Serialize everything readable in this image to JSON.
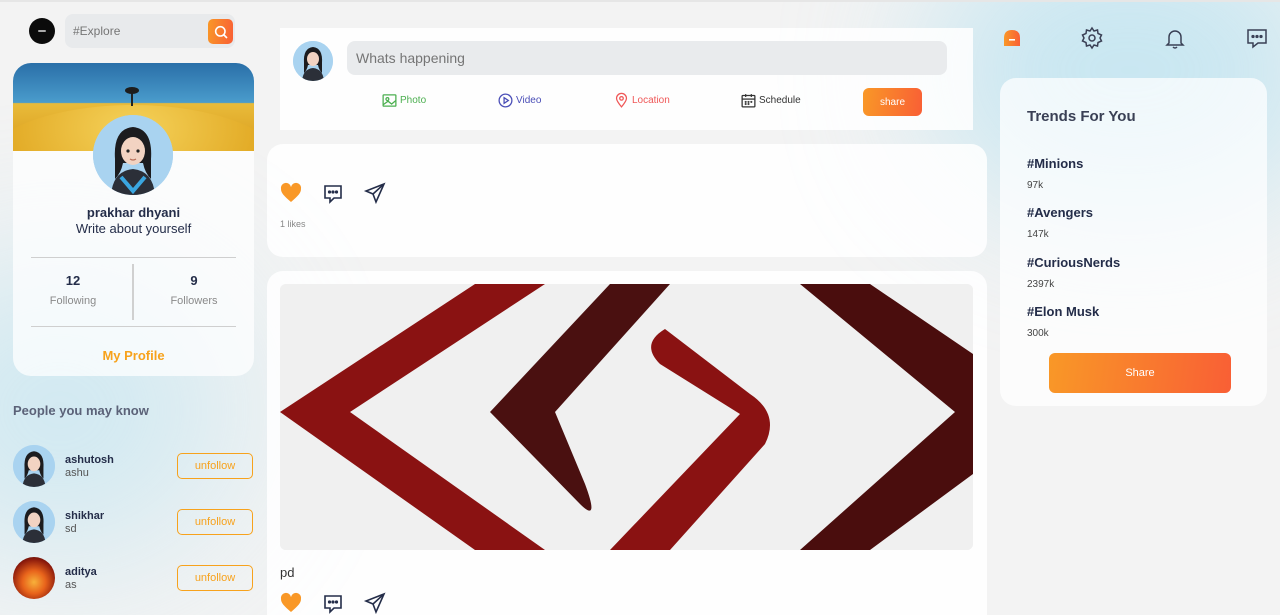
{
  "colors": {
    "accent": "#f99827",
    "accent_end": "#f95f35",
    "text": "#242d49",
    "photo": "#4caf50",
    "video": "#4a4eb7",
    "location": "#ef5757",
    "schedule": "#333333"
  },
  "header": {
    "search": {
      "placeholder": "#Explore",
      "value": ""
    },
    "logo": "app-logo"
  },
  "profile_card": {
    "name": "prakhar dhyani",
    "bio": "Write about yourself",
    "following_count": "12",
    "following_label": "Following",
    "followers_count": "9",
    "followers_label": "Followers",
    "my_profile_label": "My Profile"
  },
  "people_you_may_know": {
    "title": "People you may know",
    "users": [
      {
        "name": "ashutosh",
        "handle": "ashu",
        "button": "unfollow",
        "avatar": "avatar-girl"
      },
      {
        "name": "shikhar",
        "handle": "sd",
        "button": "unfollow",
        "avatar": "avatar-girl"
      },
      {
        "name": "aditya",
        "handle": "as",
        "button": "unfollow",
        "avatar": "avatar-fire"
      }
    ]
  },
  "share_box": {
    "placeholder": "Whats happening",
    "options": [
      {
        "label": "Photo",
        "icon": "photo-icon"
      },
      {
        "label": "Video",
        "icon": "video-icon"
      },
      {
        "label": "Location",
        "icon": "location-icon"
      },
      {
        "label": "Schedule",
        "icon": "calendar-icon"
      }
    ],
    "share_label": "share"
  },
  "feed": {
    "posts": [
      {
        "likes_text": "1 likes",
        "caption": "",
        "liked": true
      },
      {
        "caption": "pd",
        "liked": true,
        "image": "brand-logo-image"
      }
    ]
  },
  "right_nav": {
    "icons": [
      "home-icon",
      "settings-icon",
      "notifications-icon",
      "messages-icon"
    ]
  },
  "trends": {
    "title": "Trends For You",
    "items": [
      {
        "tag": "#Minions",
        "count": "97k"
      },
      {
        "tag": "#Avengers",
        "count": "147k"
      },
      {
        "tag": "#CuriousNerds",
        "count": "2397k"
      },
      {
        "tag": "#Elon Musk",
        "count": "300k"
      }
    ],
    "share_label": "Share"
  }
}
